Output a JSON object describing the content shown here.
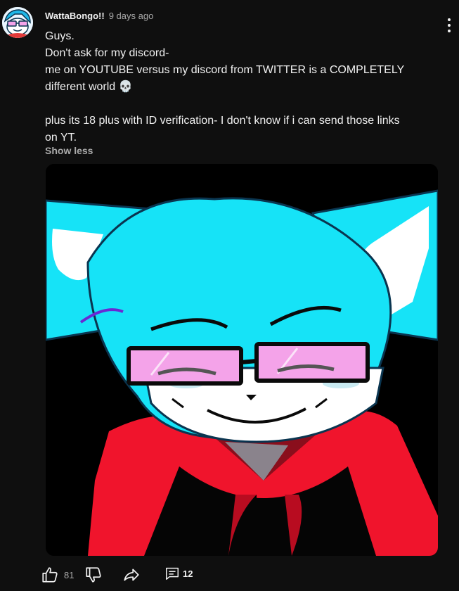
{
  "comment": {
    "author": "WattaBongo!!",
    "time": "9 days ago",
    "lines": [
      "Guys.",
      "Don't ask for my discord-",
      "me on YOUTUBE versus my discord from TWITTER is a COMPLETELY",
      "different world 💀",
      "",
      "plus its 18 plus with ID verification- I don't know if i can send those links",
      "on YT."
    ],
    "show_less": "Show less"
  },
  "actions": {
    "like_count": "81",
    "reply_count": "12"
  },
  "icons": {
    "menu": "more-vert-icon",
    "like": "thumbs-up-icon",
    "dislike": "thumbs-down-icon",
    "share": "share-icon",
    "replies": "comment-icon"
  },
  "colors": {
    "background": "#0f0f0f",
    "text_primary": "#f1f1f1",
    "text_secondary": "#aaaaaa",
    "character_cyan": "#16e3f7",
    "hoodie_red": "#f0142c",
    "glasses_pink": "#f4a3e9"
  }
}
